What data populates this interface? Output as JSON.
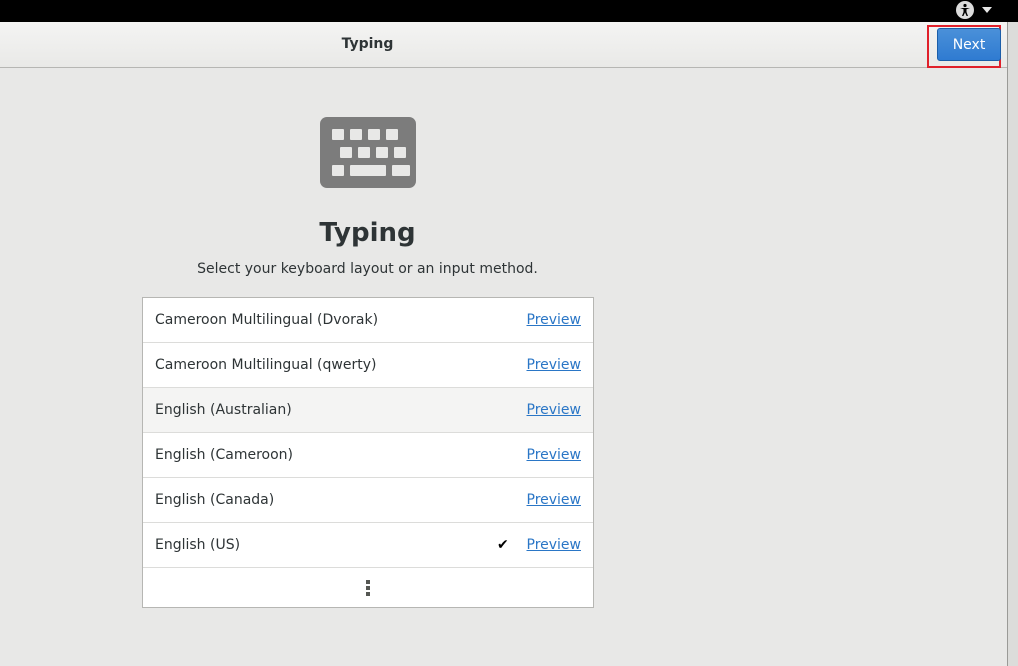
{
  "header": {
    "title": "Typing",
    "next_label": "Next"
  },
  "main": {
    "title": "Typing",
    "subtitle": "Select your keyboard layout or an input method."
  },
  "layouts": [
    {
      "name": "Cameroon Multilingual (Dvorak)",
      "preview_label": "Preview"
    },
    {
      "name": "Cameroon Multilingual (qwerty)",
      "preview_label": "Preview"
    },
    {
      "name": "English (Australian)",
      "preview_label": "Preview"
    },
    {
      "name": "English (Cameroon)",
      "preview_label": "Preview"
    },
    {
      "name": "English (Canada)",
      "preview_label": "Preview"
    },
    {
      "name": "English (US)",
      "preview_label": "Preview",
      "check": "✔"
    }
  ],
  "icons": {
    "topbar": [
      "accessibility-icon",
      "chevron-down-icon"
    ],
    "hero": "keyboard-icon",
    "more": "more-vertical-icon"
  },
  "colors": {
    "accent": "#3584e4",
    "link": "#2a76c6",
    "highlight_box": "#e0202a"
  }
}
